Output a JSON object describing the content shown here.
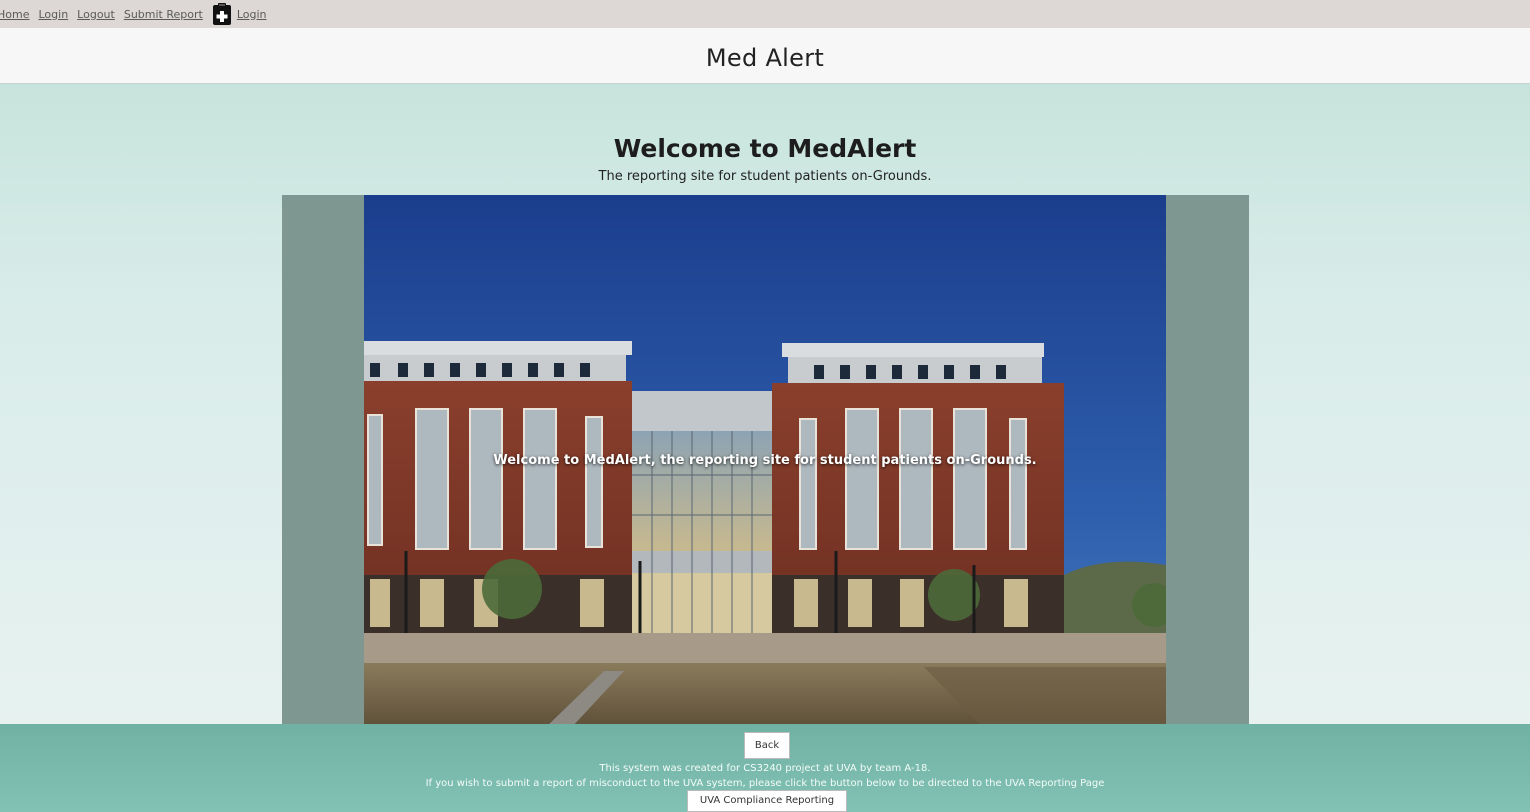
{
  "nav": {
    "items": [
      "Home",
      "Login",
      "Logout",
      "Submit Report"
    ],
    "icon": "medical-clipboard-icon",
    "after_icon": "Login"
  },
  "title": "Med Alert",
  "welcome": {
    "heading": "Welcome to MedAlert",
    "subheading": "The reporting site for student patients on-Grounds."
  },
  "carousel": {
    "caption": "Welcome to MedAlert, the reporting site for student patients on-Grounds."
  },
  "footer": {
    "back_label": "Back",
    "line1": "This system was created for CS3240 project at UVA by team A-18.",
    "line2": "If you wish to submit a report of misconduct to the UVA system, please click the button below to be directed to the UVA Reporting Page",
    "report_button": "UVA Compliance Reporting Page"
  },
  "colors": {
    "nav_bg": "#ddd8d6",
    "main_bg": "#d9ecea",
    "footer_bg": "#7bbcae",
    "carousel_frame": "#7e9790"
  }
}
